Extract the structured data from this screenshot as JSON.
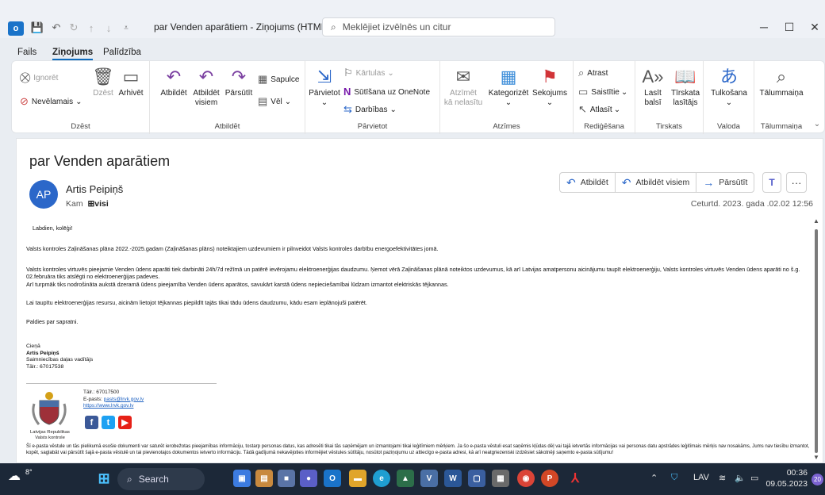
{
  "window": {
    "title": "par Venden aparātiem  -  Ziņojums (HTML)",
    "search_placeholder": "Meklējiet izvēlnēs un citur"
  },
  "menu": [
    "Fails",
    "Ziņojums",
    "Palīdzība"
  ],
  "ribbon": {
    "groups": [
      "Dzēst",
      "Atbildēt",
      "Pārvietot",
      "Atzīmes",
      "Rediģēšana",
      "Tirskats",
      "Valoda",
      "Tālummaiņa"
    ],
    "delete": {
      "ignore": "Ignorēt",
      "junk": "Nevēlamais",
      "delete": "Dzēst",
      "archive": "Arhivēt"
    },
    "respond": {
      "reply": "Atbildēt",
      "reply_all_1": "Atbildēt",
      "reply_all_2": "visiem",
      "forward": "Pārsūtīt",
      "meeting": "Sapulce",
      "more": "Vēl"
    },
    "move": {
      "move": "Pārvietot",
      "rules": "Kārtulas",
      "onenote": "Sūtīšana uz OneNote",
      "actions": "Darbības"
    },
    "tags": {
      "unread_1": "Atzīmēt",
      "unread_2": "kā nelasītu",
      "categorize": "Kategorizēt",
      "follow": "Sekojums"
    },
    "editing": {
      "find": "Atrast",
      "related": "Saistītie",
      "select": "Atlasīt"
    },
    "immersive": {
      "read_1": "Lasīt",
      "read_2": "balsī",
      "reader_1": "Tīrskata",
      "reader_2": "lasītājs"
    },
    "language": {
      "translate": "Tulkošana"
    },
    "zoom": {
      "zoom": "Tālummaiņa"
    }
  },
  "message": {
    "subject": "par Venden aparātiem",
    "avatar": "AP",
    "sender": "Artis Peipiņš",
    "to_label": "Kam",
    "to_value": "⊞visi",
    "date": "Ceturtd. 2023. gada .02.02 12:56",
    "actions": {
      "reply": "Atbildēt",
      "reply_all": "Atbildēt visiem",
      "forward": "Pārsūtīt"
    },
    "body": [
      "Labdien, kolēģi!",
      "Valsts kontroles Zaļināšanas plāna 2022.-2025.gadam (Zaļināšanas plāns) noteiktajiem uzdevumiem ir pilnveidot Valsts kontroles darbību energoefektivitātes jomā.",
      "Valsts kontroles virtuvēs pieejamie Venden ūdens aparāti  tiek darbināti 24h/7d režīmā un patērē ievērojamu elektroenerģijas daudzumu. Ņemot vērā Zaļināšanas plānā noteiktos uzdevumus, kā arī Latvijas amatpersonu aicinājumu taupīt elektroenerģiju, Valsts kontroles virtuvēs Venden ūdens aparāti no š.g. 02.februāra tiks atslēgti no elektroenerģijas padeves.",
      "Arī turpmāk tiks nodrošināta aukstā dzeramā ūdens pieejamība Venden ūdens aparātos, savukārt karstā ūdens nepieciešamībai lūdzam izmantot elektriskās tējkannas.",
      "Lai taupītu elektroenerģijas resursu, aicinām  lietojot tējkannas  piepildīt tajās tikai tādu  ūdens daudzumu, kādu  esam ieplānojuši patērēt.",
      "Paldies par sapratni."
    ],
    "signature": {
      "closing": "Cieņā",
      "name": "Artis Peipiņš",
      "position": "Saimniecības daļas vadītājs",
      "phone": "Tālr.: 67017538"
    },
    "org": {
      "caption_1": "Latvijas Republikas",
      "caption_2": "Valsts kontrole",
      "phone": "Tālr.: 67017500",
      "email_label": "E-pasts: ",
      "email": "pasts@lrvk.gov.lv",
      "web": "https://www.lrvk.gov.lv"
    },
    "disclaimer": "Šī e-pasta vēstule un tās pielikumā esošie dokumenti var saturēt ierobežotas pieejamības informāciju, tostarp personas datus, kas adresēti tikai tās saņēmējam un izmantojami tikai leģitīmiem mērķiem. Ja šo e-pasta vēstuli esat saņēmis kļūdas dēļ vai tajā ietvertās informācijas vai personas datu apstrādes leģitīmais mērķis nav nosakāms, Jums nav tiesību izmantot, kopēt, saglabāt vai pārsūtīt šajā e-pasta vēstulē un tai pievienotajos dokumentos ietverto informāciju. Tādā gadījumā nekavējoties informējiet vēstules sūtītāju, nosūtot paziņojumu uz attiecīgo e-pasta adresi, kā arī neatgriezeniski izdzēsiet sākotnēji saņemto e-pasta sūtījumu!"
  },
  "taskbar": {
    "weather": "8°",
    "search": "Search",
    "lang": "LAV",
    "time": "00:36",
    "date": "09.05.2023",
    "badge": "20"
  }
}
